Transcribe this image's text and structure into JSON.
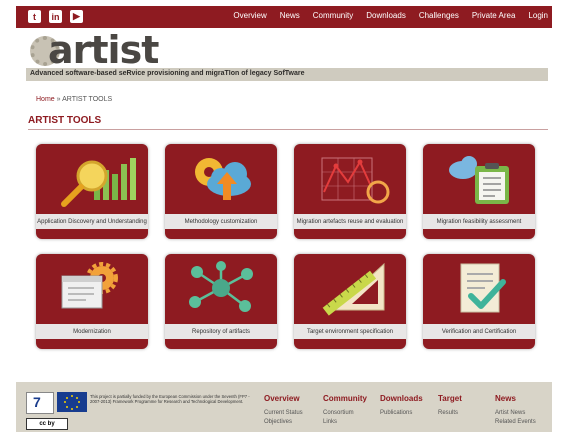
{
  "social": [
    "twitter-icon",
    "linkedin-icon",
    "youtube-icon"
  ],
  "nav": [
    "Overview",
    "News",
    "Community",
    "Downloads",
    "Challenges",
    "Private Area",
    "Login"
  ],
  "logo": {
    "name": "artist",
    "tagline": "Advanced software-based seRvice provisioning and migraTIon of legacy SofTware"
  },
  "breadcrumb": {
    "home": "Home",
    "sep": " » ",
    "current": "ARTIST TOOLS"
  },
  "page_title": "ARTIST TOOLS",
  "tiles": [
    {
      "label": "Application Discovery and Understanding",
      "icon": "magnifier-chart-icon"
    },
    {
      "label": "Methodology customization",
      "icon": "cloud-upload-icon"
    },
    {
      "label": "Migration artefacts reuse and evaluation",
      "icon": "line-chart-icon"
    },
    {
      "label": "Migration feasibility assessment",
      "icon": "clipboard-cloud-icon"
    },
    {
      "label": "Modernization",
      "icon": "window-gear-icon"
    },
    {
      "label": "Repository of artifacts",
      "icon": "network-icon"
    },
    {
      "label": "Target environment specification",
      "icon": "ruler-triangle-icon"
    },
    {
      "label": "Verification and Certification",
      "icon": "document-check-icon"
    }
  ],
  "footer": {
    "funding": "This project is partially funded by the European Commission under the Seventh (FP7 - 2007-2013) Framework Programme for Research and Technological Development.",
    "license": "cc by",
    "columns": [
      {
        "title": "Overview",
        "links": [
          "Current Status",
          "Objectives"
        ]
      },
      {
        "title": "Community",
        "links": [
          "Consortium",
          "Links"
        ]
      },
      {
        "title": "Downloads",
        "links": [
          "Publications"
        ]
      },
      {
        "title": "Target",
        "links": [
          "Results"
        ]
      },
      {
        "title": "News",
        "links": [
          "Artist News",
          "Related Events"
        ]
      }
    ]
  },
  "colors": {
    "brand": "#8e1b21",
    "tile_label_bg": "#e8e6e6",
    "footer_bg": "#d8d4c8"
  }
}
